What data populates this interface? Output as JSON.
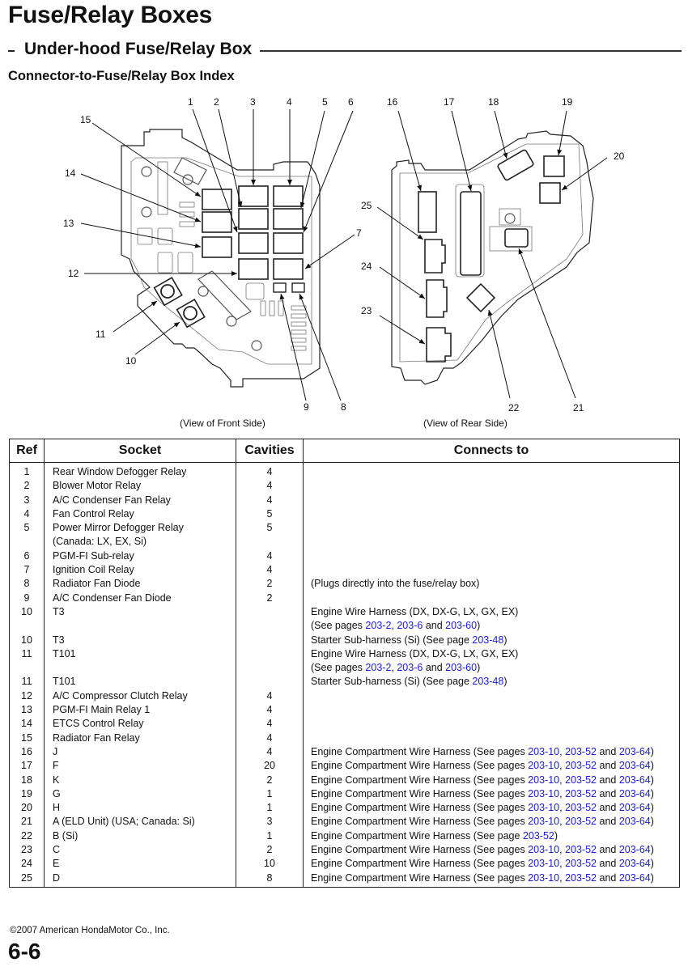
{
  "header": {
    "title": "Fuse/Relay Boxes",
    "section": "Under-hood Fuse/Relay Box",
    "subsection": "Connector-to-Fuse/Relay Box Index"
  },
  "diagram": {
    "front_caption": "(View of Front Side)",
    "rear_caption": "(View of Rear Side)",
    "callouts": [
      "1",
      "2",
      "3",
      "4",
      "5",
      "6",
      "7",
      "8",
      "9",
      "10",
      "11",
      "12",
      "13",
      "14",
      "15",
      "16",
      "17",
      "18",
      "19",
      "20",
      "21",
      "22",
      "23",
      "24",
      "25"
    ]
  },
  "table": {
    "headers": [
      "Ref",
      "Socket",
      "Cavities",
      "Connects to"
    ],
    "rows": [
      {
        "ref": "1",
        "socket": [
          "Rear Window Defogger Relay"
        ],
        "cavities": "4",
        "connects": []
      },
      {
        "ref": "2",
        "socket": [
          "Blower Motor Relay"
        ],
        "cavities": "4",
        "connects": []
      },
      {
        "ref": "3",
        "socket": [
          "A/C Condenser Fan Relay"
        ],
        "cavities": "4",
        "connects": []
      },
      {
        "ref": "4",
        "socket": [
          "Fan Control Relay"
        ],
        "cavities": "5",
        "connects": []
      },
      {
        "ref": "5",
        "socket": [
          "Power Mirror Defogger Relay",
          "(Canada: LX, EX, Si)"
        ],
        "cavities": "5",
        "connects": []
      },
      {
        "ref": "6",
        "socket": [
          "PGM-FI Sub-relay"
        ],
        "cavities": "4",
        "connects": []
      },
      {
        "ref": "7",
        "socket": [
          "Ignition Coil Relay"
        ],
        "cavities": "4",
        "connects": []
      },
      {
        "ref": "8",
        "socket": [
          "Radiator Fan Diode"
        ],
        "cavities": "2",
        "connects": [
          [
            {
              "t": "(Plugs directly into the fuse/relay box)"
            }
          ]
        ]
      },
      {
        "ref": "9",
        "socket": [
          "A/C Condenser Fan Diode"
        ],
        "cavities": "2",
        "connects": []
      },
      {
        "ref": "10",
        "socket": [
          "T3"
        ],
        "cavities": "",
        "connects": [
          [
            {
              "t": "Engine Wire Harness (DX, DX-G, LX, GX, EX)"
            }
          ],
          [
            {
              "t": "(See pages "
            },
            {
              "l": "203-2"
            },
            {
              "t": ", "
            },
            {
              "l": "203-6"
            },
            {
              "t": " and "
            },
            {
              "l": "203-60"
            },
            {
              "t": ")"
            }
          ]
        ]
      },
      {
        "ref": "10",
        "socket": [
          "T3"
        ],
        "cavities": "",
        "connects": [
          [
            {
              "t": "Starter Sub-harness (Si) (See page "
            },
            {
              "l": "203-48"
            },
            {
              "t": ")"
            }
          ]
        ]
      },
      {
        "ref": "11",
        "socket": [
          "T101"
        ],
        "cavities": "",
        "connects": [
          [
            {
              "t": "Engine Wire Harness (DX, DX-G, LX, GX, EX)"
            }
          ],
          [
            {
              "t": "(See pages "
            },
            {
              "l": "203-2"
            },
            {
              "t": ", "
            },
            {
              "l": "203-6"
            },
            {
              "t": " and "
            },
            {
              "l": "203-60"
            },
            {
              "t": ")"
            }
          ]
        ]
      },
      {
        "ref": "11",
        "socket": [
          "T101"
        ],
        "cavities": "",
        "connects": [
          [
            {
              "t": "Starter Sub-harness (Si) (See page "
            },
            {
              "l": "203-48"
            },
            {
              "t": ")"
            }
          ]
        ]
      },
      {
        "ref": "12",
        "socket": [
          "A/C Compressor Clutch Relay"
        ],
        "cavities": "4",
        "connects": []
      },
      {
        "ref": "13",
        "socket": [
          "PGM-FI Main Relay 1"
        ],
        "cavities": "4",
        "connects": []
      },
      {
        "ref": "14",
        "socket": [
          "ETCS Control Relay"
        ],
        "cavities": "4",
        "connects": []
      },
      {
        "ref": "15",
        "socket": [
          "Radiator Fan Relay"
        ],
        "cavities": "4",
        "connects": []
      },
      {
        "ref": "16",
        "socket": [
          "J"
        ],
        "cavities": "4",
        "connects": [
          [
            {
              "t": "Engine Compartment Wire Harness (See pages "
            },
            {
              "l": "203-10"
            },
            {
              "t": ", "
            },
            {
              "l": "203-52"
            },
            {
              "t": " and "
            },
            {
              "l": "203-64"
            },
            {
              "t": ")"
            }
          ]
        ]
      },
      {
        "ref": "17",
        "socket": [
          "F"
        ],
        "cavities": "20",
        "connects": [
          [
            {
              "t": "Engine Compartment Wire Harness (See pages "
            },
            {
              "l": "203-10"
            },
            {
              "t": ", "
            },
            {
              "l": "203-52"
            },
            {
              "t": " and "
            },
            {
              "l": "203-64"
            },
            {
              "t": ")"
            }
          ]
        ]
      },
      {
        "ref": "18",
        "socket": [
          "K"
        ],
        "cavities": "2",
        "connects": [
          [
            {
              "t": "Engine Compartment Wire Harness (See pages "
            },
            {
              "l": "203-10"
            },
            {
              "t": ", "
            },
            {
              "l": "203-52"
            },
            {
              "t": " and "
            },
            {
              "l": "203-64"
            },
            {
              "t": ")"
            }
          ]
        ]
      },
      {
        "ref": "19",
        "socket": [
          "G"
        ],
        "cavities": "1",
        "connects": [
          [
            {
              "t": "Engine Compartment Wire Harness (See pages "
            },
            {
              "l": "203-10"
            },
            {
              "t": ", "
            },
            {
              "l": "203-52"
            },
            {
              "t": " and "
            },
            {
              "l": "203-64"
            },
            {
              "t": ")"
            }
          ]
        ]
      },
      {
        "ref": "20",
        "socket": [
          "H"
        ],
        "cavities": "1",
        "connects": [
          [
            {
              "t": "Engine Compartment Wire Harness (See pages "
            },
            {
              "l": "203-10"
            },
            {
              "t": ", "
            },
            {
              "l": "203-52"
            },
            {
              "t": " and "
            },
            {
              "l": "203-64"
            },
            {
              "t": ")"
            }
          ]
        ]
      },
      {
        "ref": "21",
        "socket": [
          "A (ELD Unit) (USA; Canada: Si)"
        ],
        "cavities": "3",
        "connects": [
          [
            {
              "t": "Engine Compartment Wire Harness (See pages "
            },
            {
              "l": "203-10"
            },
            {
              "t": ", "
            },
            {
              "l": "203-52"
            },
            {
              "t": " and "
            },
            {
              "l": "203-64"
            },
            {
              "t": ")"
            }
          ]
        ]
      },
      {
        "ref": "22",
        "socket": [
          "B (Si)"
        ],
        "cavities": "1",
        "connects": [
          [
            {
              "t": "Engine Compartment Wire Harness (See page "
            },
            {
              "l": "203-52"
            },
            {
              "t": ")"
            }
          ]
        ]
      },
      {
        "ref": "23",
        "socket": [
          "C"
        ],
        "cavities": "2",
        "connects": [
          [
            {
              "t": "Engine Compartment Wire Harness (See pages "
            },
            {
              "l": "203-10"
            },
            {
              "t": ", "
            },
            {
              "l": "203-52"
            },
            {
              "t": " and "
            },
            {
              "l": "203-64"
            },
            {
              "t": ")"
            }
          ]
        ]
      },
      {
        "ref": "24",
        "socket": [
          "E"
        ],
        "cavities": "10",
        "connects": [
          [
            {
              "t": "Engine Compartment Wire Harness (See pages "
            },
            {
              "l": "203-10"
            },
            {
              "t": ", "
            },
            {
              "l": "203-52"
            },
            {
              "t": " and "
            },
            {
              "l": "203-64"
            },
            {
              "t": ")"
            }
          ]
        ]
      },
      {
        "ref": "25",
        "socket": [
          "D"
        ],
        "cavities": "8",
        "connects": [
          [
            {
              "t": "Engine Compartment Wire Harness (See pages "
            },
            {
              "l": "203-10"
            },
            {
              "t": ", "
            },
            {
              "l": "203-52"
            },
            {
              "t": " and "
            },
            {
              "l": "203-64"
            },
            {
              "t": ")"
            }
          ]
        ]
      }
    ]
  },
  "footer": {
    "copyright": "©2007 American HondaMotor Co., Inc.",
    "page_number": "6-6"
  },
  "colors": {
    "link": "#1a1adb",
    "text": "#111111"
  }
}
